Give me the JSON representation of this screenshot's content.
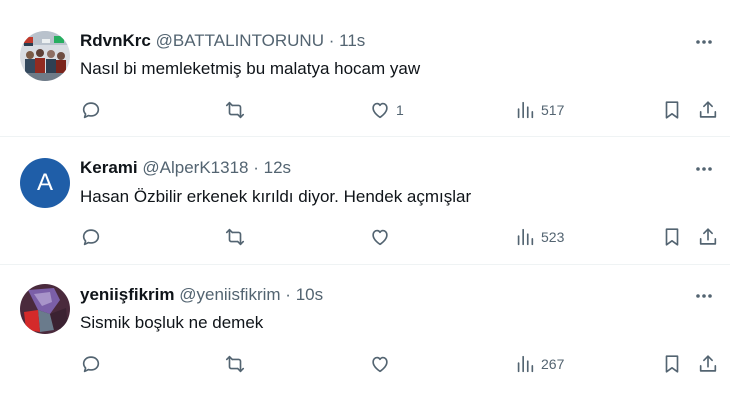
{
  "tweets": [
    {
      "name": "RdvnKrc",
      "handle": "@BATTALINTORUNU",
      "sep": "·",
      "time": "11s",
      "text": "Nasıl bi memleketmiş bu malatya hocam yaw",
      "likes": "1",
      "views": "517",
      "avatar": "photo-avatar"
    },
    {
      "name": "Kerami",
      "handle": "@AlperK1318",
      "sep": "·",
      "time": "12s",
      "text": "Hasan Özbilir erkenek kırıldı diyor. Hendek açmışlar",
      "likes": "",
      "views": "523",
      "avatar_letter": "A",
      "avatar_color": "#1f5ea8"
    },
    {
      "name": "yeniişfikrim",
      "handle": "@yeniisfikrim",
      "sep": "·",
      "time": "10s",
      "text": "Sismik boşluk ne demek",
      "likes": "",
      "views": "267",
      "avatar": "abstract-avatar"
    }
  ],
  "icons": {
    "reply": "reply-icon",
    "retweet": "retweet-icon",
    "like": "like-icon",
    "views": "views-icon",
    "bookmark": "bookmark-icon",
    "share": "share-icon",
    "more": "more-icon"
  },
  "colors": {
    "text": "#0f1419",
    "secondary": "#536471",
    "divider": "#eff3f4"
  }
}
